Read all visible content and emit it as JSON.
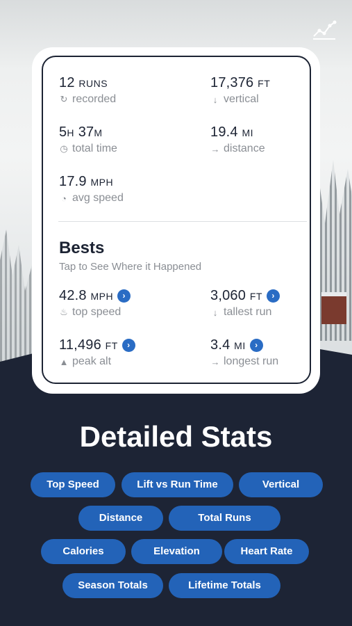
{
  "stats": {
    "runs": {
      "value": "12",
      "unit": "RUNS",
      "label": "recorded",
      "icon": "refresh-icon"
    },
    "vertical": {
      "value": "17,376",
      "unit": "FT",
      "label": "vertical",
      "icon": "arrow-down-icon"
    },
    "time": {
      "value_h": "5",
      "unit_h": "H",
      "value_m": "37",
      "unit_m": "M",
      "label": "total time",
      "icon": "clock-icon"
    },
    "distance": {
      "value": "19.4",
      "unit": "MI",
      "label": "distance",
      "icon": "arrow-right-icon"
    },
    "avg_speed": {
      "value": "17.9",
      "unit": "MPH",
      "label": "avg speed",
      "icon": "gauge-icon"
    }
  },
  "bests": {
    "title": "Bests",
    "subtitle": "Tap to See Where it Happened",
    "top_speed": {
      "value": "42.8",
      "unit": "MPH",
      "label": "top speed",
      "icon": "flame-icon"
    },
    "tallest_run": {
      "value": "3,060",
      "unit": "FT",
      "label": "tallest run",
      "icon": "arrow-down-icon"
    },
    "peak_alt": {
      "value": "11,496",
      "unit": "FT",
      "label": "peak alt",
      "icon": "mountain-icon"
    },
    "longest_run": {
      "value": "3.4",
      "unit": "MI",
      "label": "longest run",
      "icon": "arrow-right-icon"
    }
  },
  "headline": "Detailed Stats",
  "pills": [
    "Top  Speed",
    "Lift vs Run Time",
    "Vertical",
    "Distance",
    "Total Runs",
    "Calories",
    "Elevation",
    "Heart Rate",
    "Season Totals",
    "Lifetime Totals"
  ],
  "colors": {
    "accent": "#2363b8",
    "dark": "#1c2333",
    "muted": "#8a8e94"
  }
}
